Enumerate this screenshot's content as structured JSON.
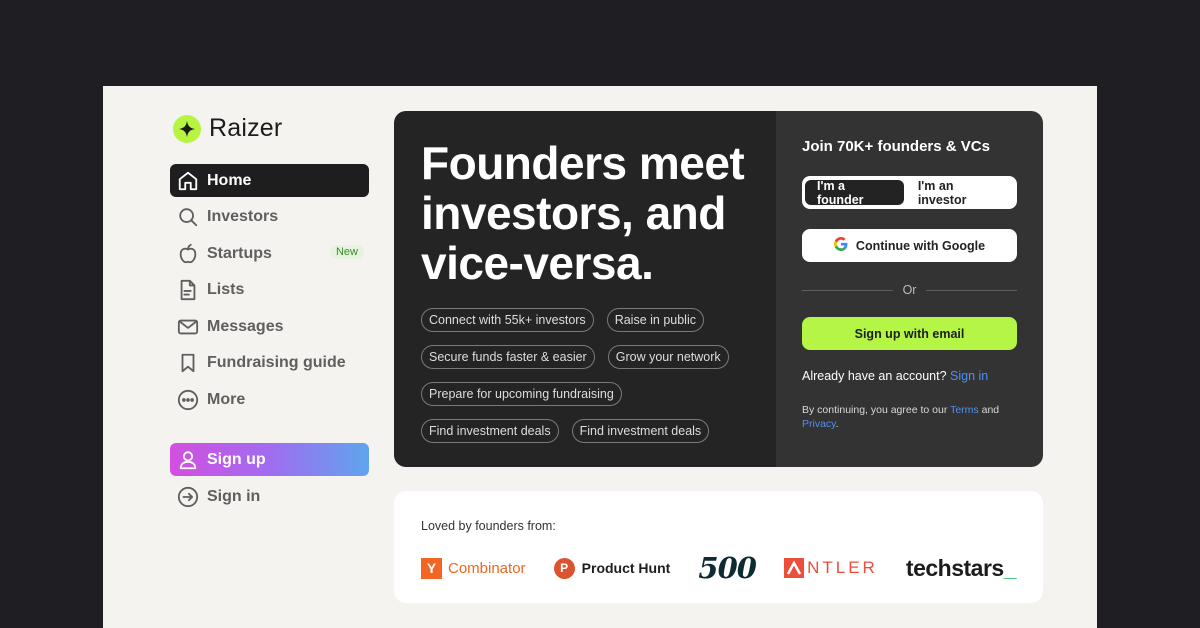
{
  "brand": {
    "name": "Raizer",
    "icon": "sparkle-icon",
    "accent": "#b7f542"
  },
  "sidebar": {
    "items": [
      {
        "label": "Home",
        "icon": "home-icon",
        "active": true
      },
      {
        "label": "Investors",
        "icon": "search-icon"
      },
      {
        "label": "Startups",
        "icon": "apple-icon",
        "badge": "New"
      },
      {
        "label": "Lists",
        "icon": "document-icon"
      },
      {
        "label": "Messages",
        "icon": "mail-icon"
      },
      {
        "label": "Fundraising guide",
        "icon": "bookmark-icon"
      },
      {
        "label": "More",
        "icon": "more-icon"
      }
    ],
    "signup_label": "Sign up",
    "signin_label": "Sign in"
  },
  "hero": {
    "headline": "Founders meet investors, and vice-versa.",
    "chips": [
      "Connect with 55k+ investors",
      "Raise in public",
      "Secure funds faster & easier",
      "Grow your network",
      "Prepare for upcoming fundraising",
      "Find investment deals",
      "Find investment deals"
    ]
  },
  "signup_panel": {
    "title": "Join 70K+ founders & VCs",
    "role_founder": "I'm a founder",
    "role_investor": "I'm an investor",
    "google_label": "Continue with Google",
    "or_label": "Or",
    "email_label": "Sign up with email",
    "have_account": "Already have an account?",
    "signin_link": "Sign in",
    "legal_prefix": "By continuing, you agree to our",
    "terms": "Terms",
    "and": "and",
    "privacy": "Privacy",
    "period": "."
  },
  "loved": {
    "title": "Loved by founders from:",
    "logos": {
      "yc_mark": "Y",
      "yc_text": "Combinator",
      "ph_mark": "P",
      "ph_text": "Product Hunt",
      "five_hundred": "500",
      "antler": "NTLER",
      "techstars": "techstars",
      "techstars_mark": "_"
    }
  },
  "colors": {
    "dark_panel": "#242424",
    "signup_panel": "#333333",
    "email_button": "#b5f545",
    "link": "#4f8ff5"
  }
}
